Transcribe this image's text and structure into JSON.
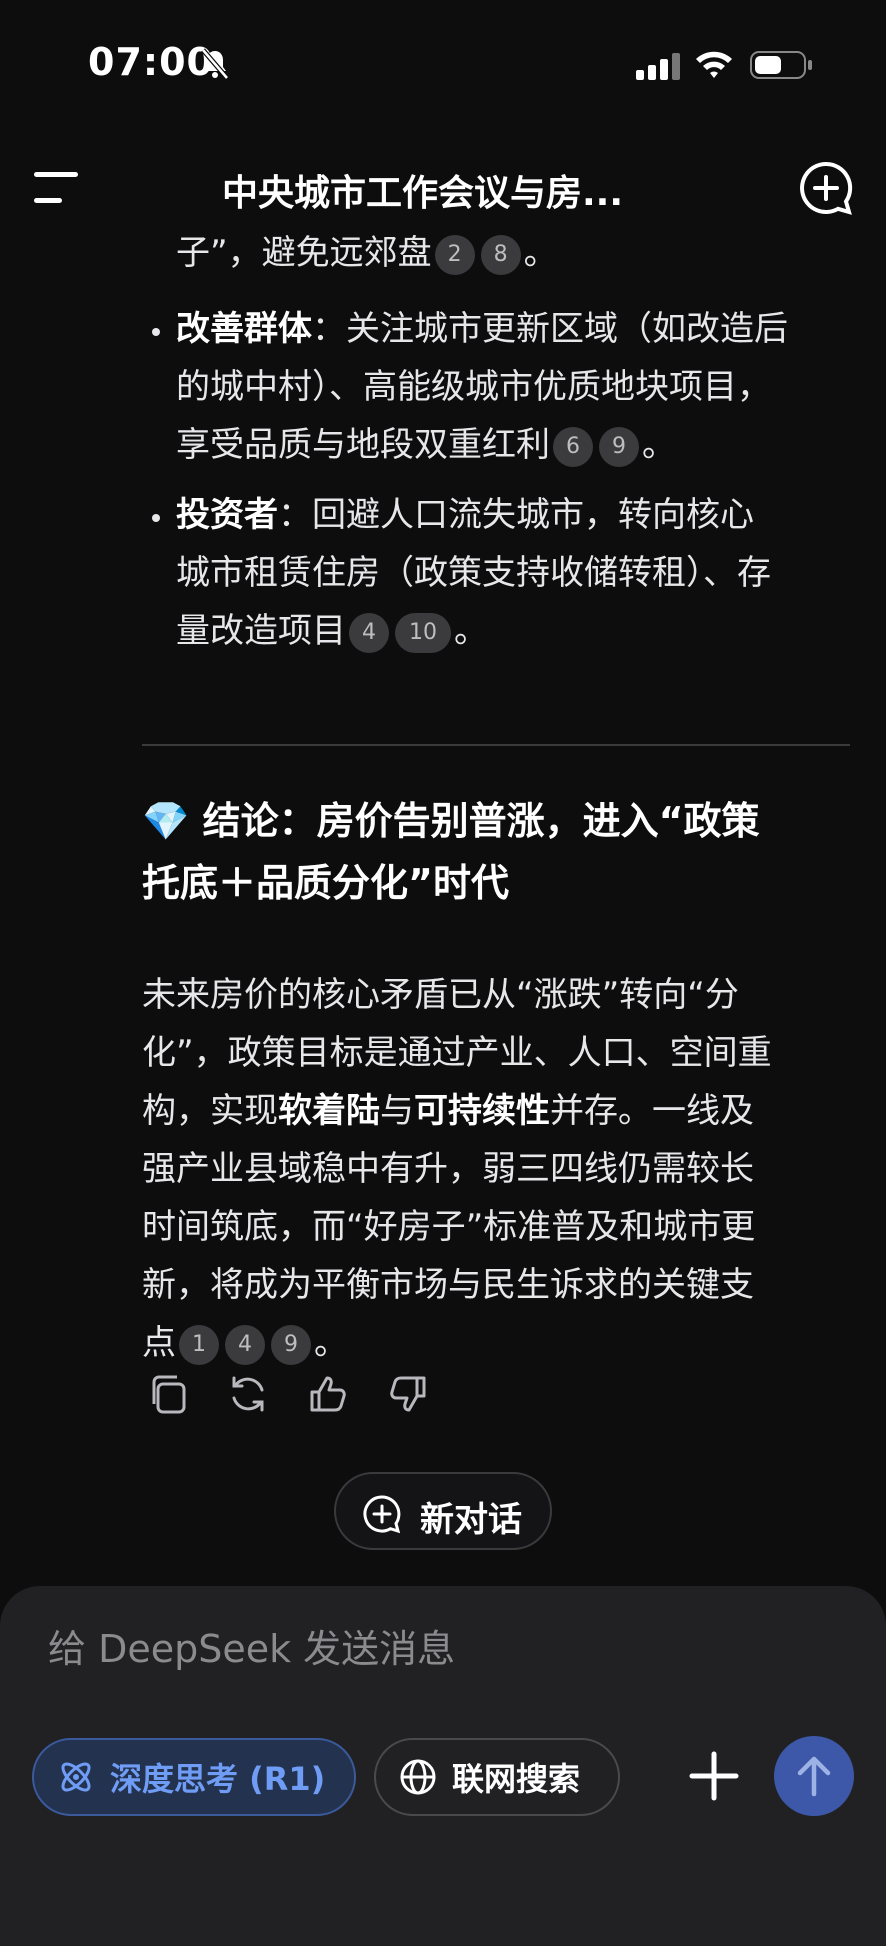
{
  "status_bar": {
    "time": "07:00"
  },
  "header": {
    "title": "中央城市工作会议与房..."
  },
  "bullets_top": {
    "line0_text": "子”，避免远郊盘",
    "line0_cites": [
      "2",
      "8"
    ],
    "line0_end": "。"
  },
  "bullets": [
    {
      "label": "改善群体",
      "line1": "：关注城市更新区域（如改造后",
      "line2": "的城中村）、高能级城市优质地块项目，",
      "line3": "享受品质与地段双重红利",
      "cites": [
        "6",
        "9"
      ],
      "end": "。"
    },
    {
      "label": "投资者",
      "line1": "：回避人口流失城市，转向核心",
      "line2": "城市租赁住房（政策支持收储转租）、存",
      "line3": "量改造项目",
      "cites": [
        "4",
        "10"
      ],
      "end": "。"
    }
  ],
  "conclusion": {
    "emoji": "💎",
    "title_line1": "结论：房价告别普涨，进入“政策",
    "title_line2": "托底＋品质分化”时代",
    "p_line1": "未来房价的核心矛盾已从“涨跌”转向“分",
    "p_line2": "化”，政策目标是通过产业、人口、空间重",
    "p_line3_a": "构，实现",
    "p_line3_b1": "软着陆",
    "p_line3_c": "与",
    "p_line3_b2": "可持续性",
    "p_line3_d": "并存。一线及",
    "p_line4": "强产业县域稳中有升，弱三四线仍需较长",
    "p_line5": "时间筑底，而“好房子”标准普及和城市更",
    "p_line6": "新，将成为平衡市场与民生诉求的关键支",
    "p_line7": "点",
    "cites": [
      "1",
      "4",
      "9"
    ],
    "end": "。"
  },
  "actions": [
    "copy-icon",
    "regenerate-icon",
    "thumbs-up-icon",
    "thumbs-down-icon"
  ],
  "new_conversation": {
    "label": "新对话"
  },
  "composer": {
    "placeholder": "给 DeepSeek 发送消息",
    "deep_think_label": "深度思考 (R1)",
    "web_search_label": "联网搜索"
  },
  "colors": {
    "background": "#0d0d0e",
    "accent_blue": "#6f9cf5",
    "send_button": "#3d58a8",
    "citation_bg": "#3b3b3e"
  }
}
